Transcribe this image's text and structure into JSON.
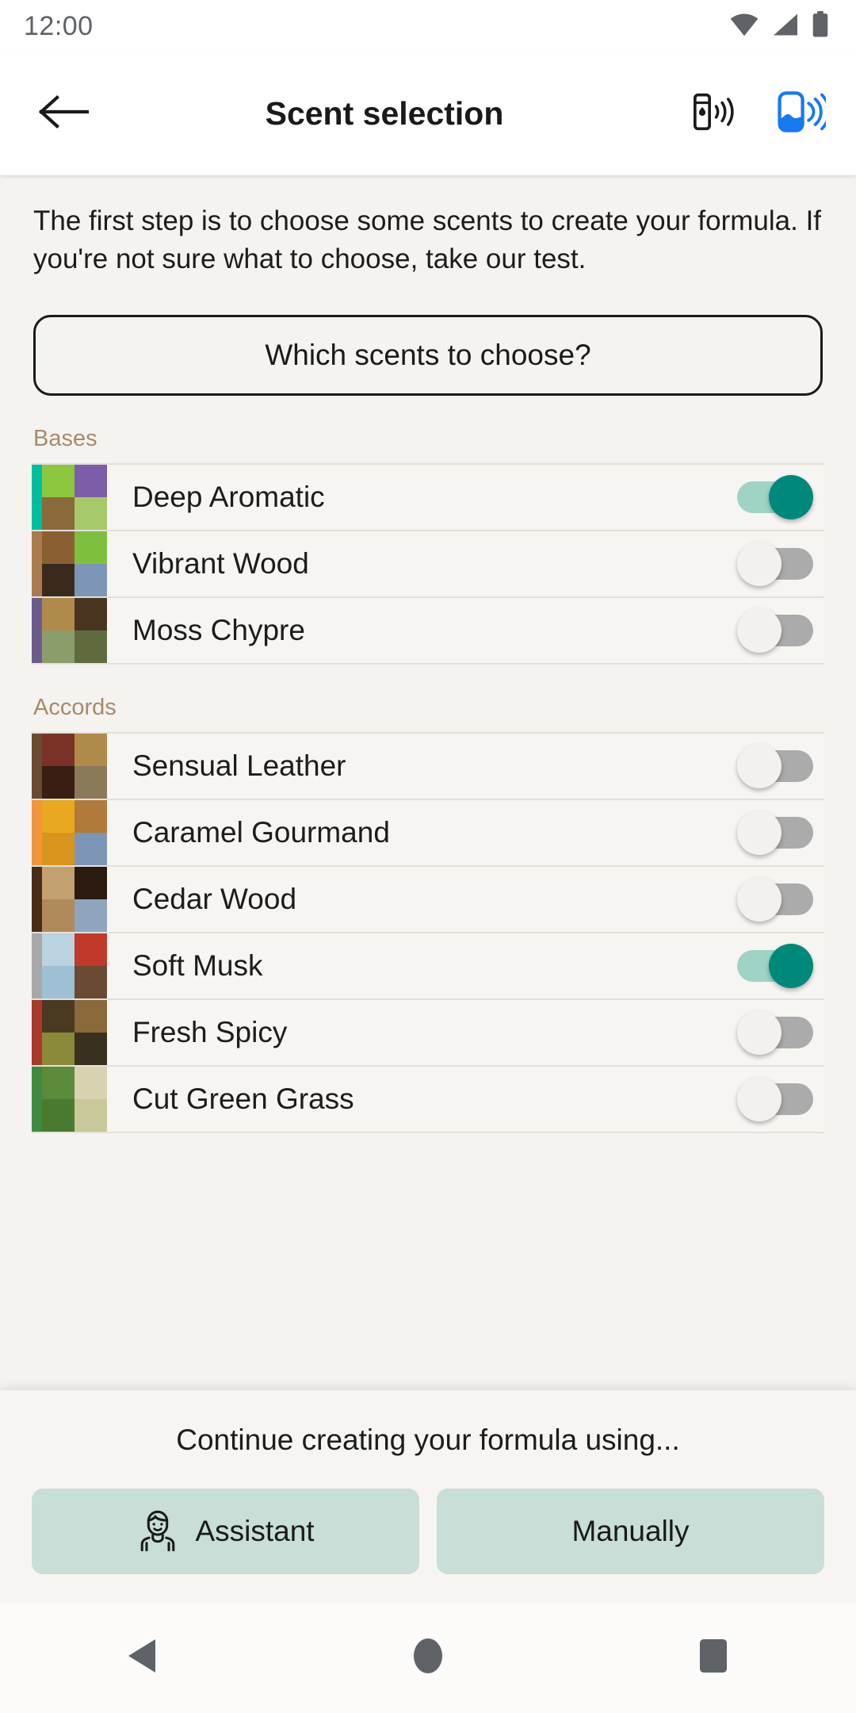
{
  "status_bar": {
    "time": "12:00",
    "icons": [
      "wifi-icon",
      "cellular-signal-icon",
      "battery-icon"
    ],
    "icon_color": "#5F6368"
  },
  "app_bar": {
    "back_label": "back-arrow-icon",
    "title": "Scent selection",
    "actions": [
      {
        "name": "diffuser-device-icon",
        "color": "#1A1A1A"
      },
      {
        "name": "scent-device-connected-icon",
        "color": "#1878F0"
      }
    ]
  },
  "intro": {
    "text": "The first step is to choose some scents to create your formula. If you're not sure what to choose, take our test."
  },
  "help_button": {
    "label": "Which scents to choose?"
  },
  "sections": [
    {
      "label": "Bases",
      "items": [
        {
          "name": "Deep Aromatic",
          "accent": "#00BFA0",
          "on": true,
          "thumb": [
            "#8CC63F",
            "#7B5EA7",
            "#8A6A3A",
            "#A8C96B"
          ]
        },
        {
          "name": "Vibrant Wood",
          "accent": "#A97B4F",
          "on": false,
          "thumb": [
            "#8A6033",
            "#7FBF3F",
            "#3A2A1E",
            "#7E96B5"
          ]
        },
        {
          "name": "Moss Chypre",
          "accent": "#6C5B8C",
          "on": false,
          "thumb": [
            "#B08A4A",
            "#4A3520",
            "#8A9E6B",
            "#5F6B3F"
          ]
        }
      ]
    },
    {
      "label": "Accords",
      "items": [
        {
          "name": "Sensual Leather",
          "accent": "#6B4A33",
          "on": false,
          "thumb": [
            "#7A3226",
            "#B08A4A",
            "#3A1E14",
            "#8A7A5A"
          ]
        },
        {
          "name": "Caramel Gourmand",
          "accent": "#F0953C",
          "on": false,
          "thumb": [
            "#E8A820",
            "#B07A3A",
            "#D9941E",
            "#7E96B5"
          ]
        },
        {
          "name": "Cedar Wood",
          "accent": "#4A2C1A",
          "on": false,
          "thumb": [
            "#C2A070",
            "#2A1A10",
            "#B08A5A",
            "#8FA4BD"
          ]
        },
        {
          "name": "Soft Musk",
          "accent": "#A8A8A8",
          "on": true,
          "thumb": [
            "#BBD3E0",
            "#C0392B",
            "#9FC0D4",
            "#6B4A33"
          ]
        },
        {
          "name": "Fresh Spicy",
          "accent": "#A83A2A",
          "on": false,
          "thumb": [
            "#4A3A22",
            "#8A6A3A",
            "#8A8A3A",
            "#3A3020"
          ]
        },
        {
          "name": "Cut Green Grass",
          "accent": "#3E8B3E",
          "on": false,
          "thumb": [
            "#5A8A3A",
            "#D8D2B0",
            "#4A7A30",
            "#C8C89A"
          ]
        }
      ]
    }
  ],
  "bottom_sheet": {
    "title": "Continue creating your formula using...",
    "buttons": [
      {
        "label": "Assistant",
        "icon": "assistant-person-icon"
      },
      {
        "label": "Manually",
        "icon": ""
      }
    ],
    "button_color": "#C8DED6"
  },
  "nav_bar": {
    "buttons": [
      "back-nav-icon",
      "home-nav-icon",
      "recents-nav-icon"
    ],
    "color": "#5F6368"
  },
  "theme": {
    "background": "#F5F3F0",
    "appbar_background": "#FFFFFF",
    "section_label_color": "#A68B6A",
    "toggle_on_color": "#00897B",
    "toggle_on_track": "#9ED3C6",
    "toggle_off_track": "#ABABAB"
  }
}
